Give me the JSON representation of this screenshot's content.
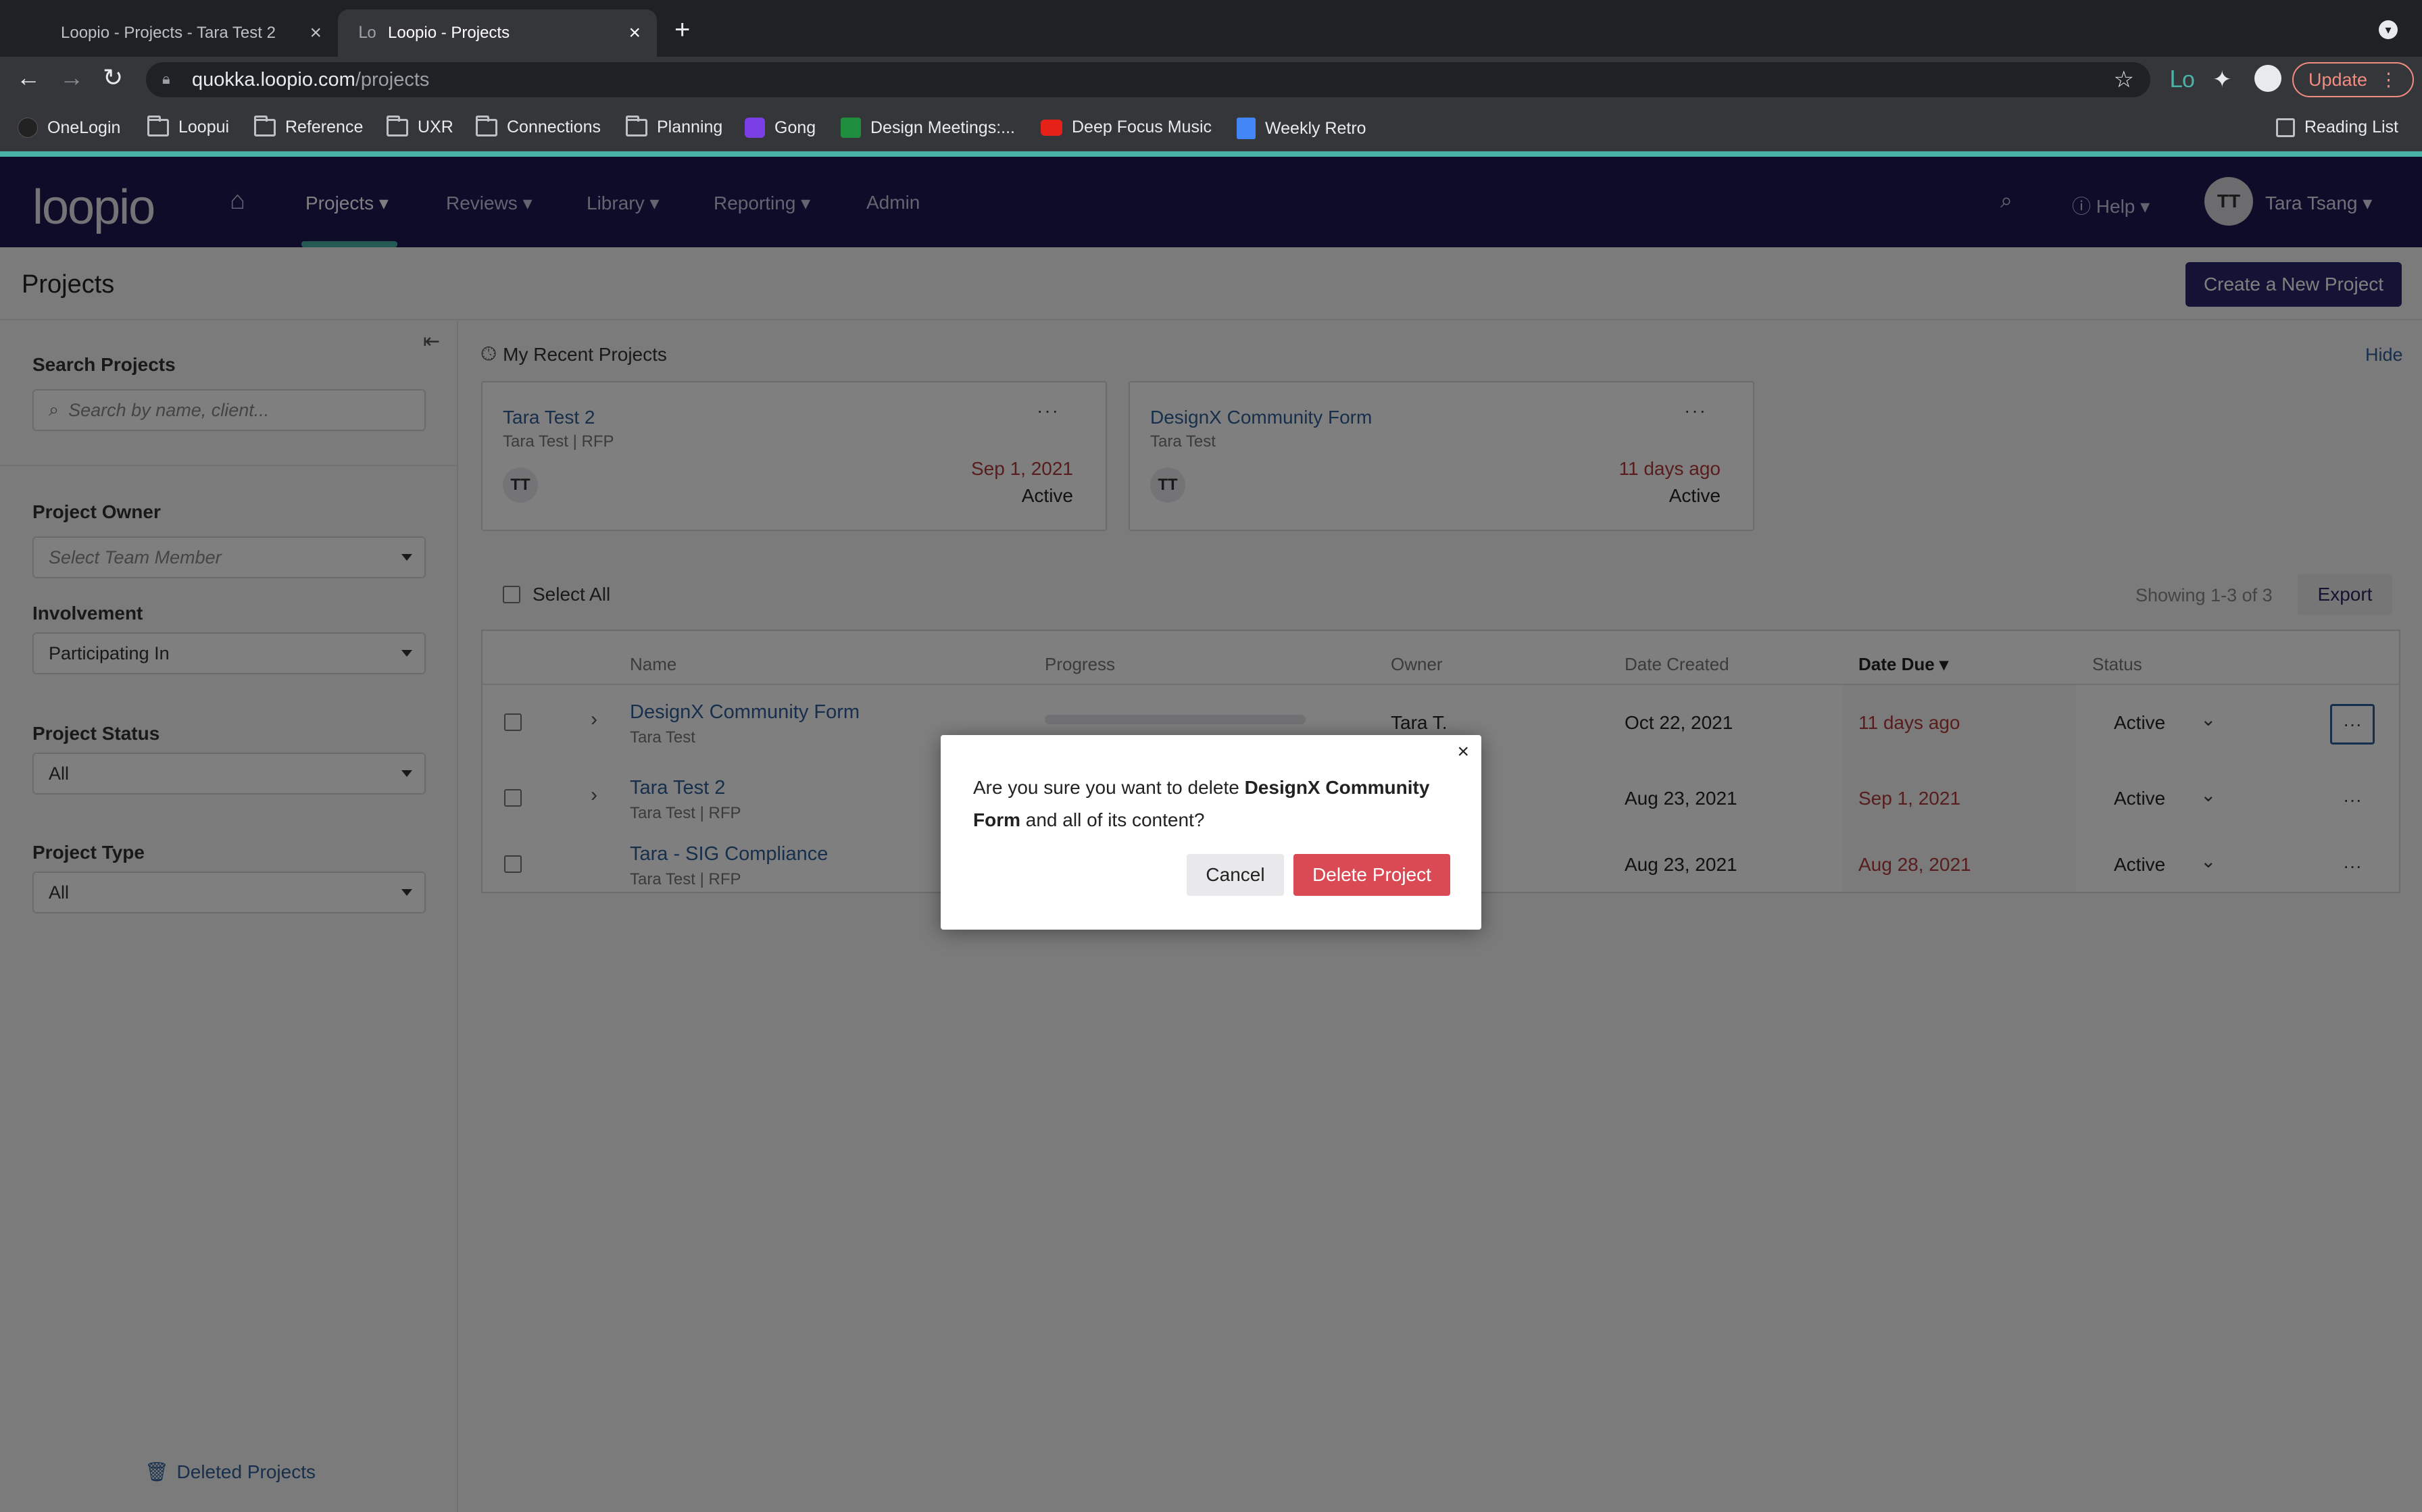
{
  "browser": {
    "tabs": [
      {
        "title": "Loopio - Projects - Tara Test 2"
      },
      {
        "title": "Loopio - Projects"
      }
    ],
    "url_host": "quokka.loopio.com",
    "url_path": "/projects",
    "update_label": "Update",
    "bookmarks": [
      "OneLogin",
      "Loopui",
      "Reference",
      "UXR",
      "Connections",
      "Planning",
      "Gong",
      "Design Meetings:...",
      "Deep Focus Music",
      "Weekly Retro"
    ],
    "reading_list": "Reading List"
  },
  "nav": {
    "logo": "loopio",
    "items": [
      "Projects",
      "Reviews",
      "Library",
      "Reporting",
      "Admin"
    ],
    "help": "Help",
    "user_initials": "TT",
    "user_name": "Tara Tsang"
  },
  "page": {
    "title": "Projects",
    "create_button": "Create a New Project"
  },
  "sidebar": {
    "search_label": "Search Projects",
    "search_placeholder": "Search by name, client...",
    "owner_label": "Project Owner",
    "owner_placeholder": "Select Team Member",
    "involvement_label": "Involvement",
    "involvement_value": "Participating In",
    "status_label": "Project Status",
    "status_value": "All",
    "type_label": "Project Type",
    "type_value": "All",
    "deleted_link": "Deleted Projects"
  },
  "recent": {
    "title": "My Recent Projects",
    "hide": "Hide",
    "cards": [
      {
        "name": "Tara Test 2",
        "sub": "Tara Test | RFP",
        "initials": "TT",
        "date": "Sep 1, 2021",
        "status": "Active"
      },
      {
        "name": "DesignX Community Form",
        "sub": "Tara Test",
        "initials": "TT",
        "date": "11 days ago",
        "status": "Active"
      }
    ]
  },
  "list": {
    "select_all": "Select All",
    "showing": "Showing 1-3 of 3",
    "export": "Export",
    "columns": [
      "Name",
      "Progress",
      "Owner",
      "Date Created",
      "Date Due",
      "Status"
    ],
    "rows": [
      {
        "name": "DesignX Community Form",
        "sub": "Tara Test",
        "progress": 0,
        "owner": "Tara T.",
        "created": "Oct 22, 2021",
        "due": "11 days ago",
        "status": "Active"
      },
      {
        "name": "Tara Test 2",
        "sub": "Tara Test | RFP",
        "progress": 0,
        "owner": "",
        "created": "Aug 23, 2021",
        "due": "Sep 1, 2021",
        "status": "Active"
      },
      {
        "name": "Tara - SIG Compliance",
        "sub": "Tara Test | RFP",
        "progress": 0,
        "owner": "",
        "created": "Aug 23, 2021",
        "due": "Aug 28, 2021",
        "status": "Active"
      }
    ]
  },
  "modal": {
    "close": "×",
    "msg_prefix": "Are you sure you want to delete ",
    "msg_project": "DesignX Community Form",
    "msg_suffix": " and all of its content?",
    "cancel": "Cancel",
    "delete": "Delete Project"
  }
}
